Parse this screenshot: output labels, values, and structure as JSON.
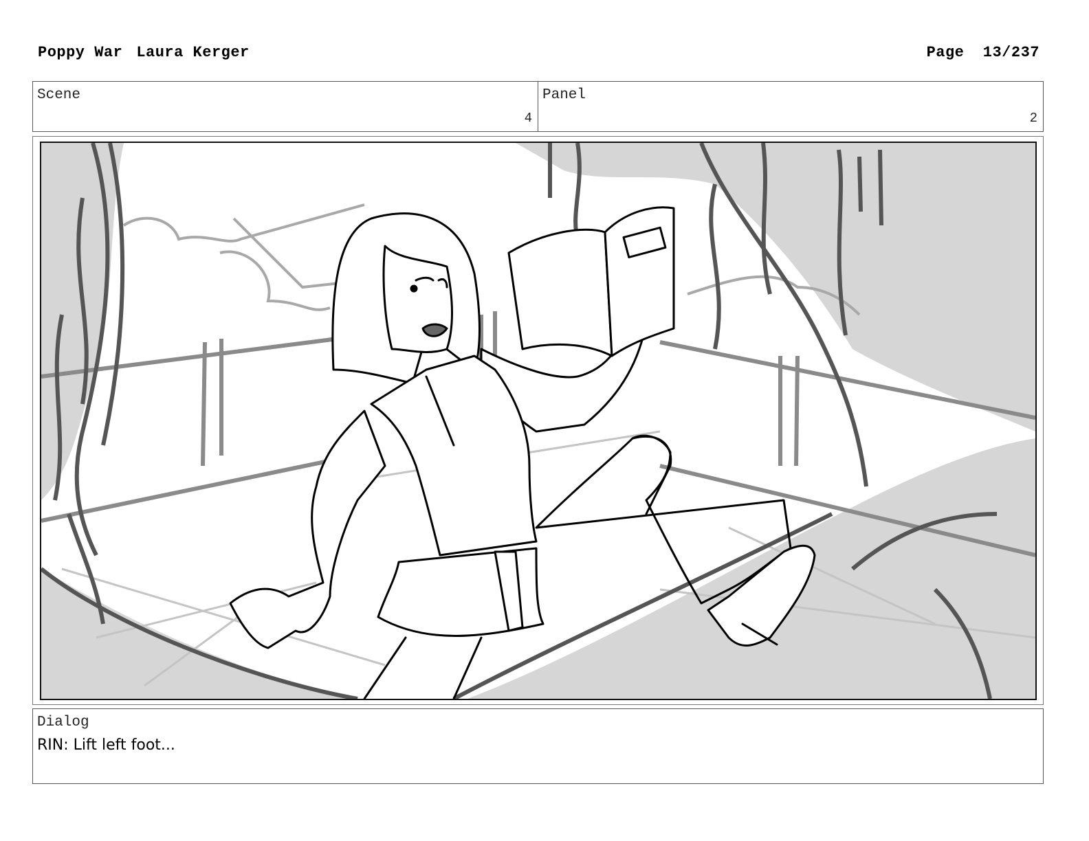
{
  "header": {
    "title": "Poppy War",
    "author": "Laura Kerger",
    "page_label": "Page",
    "page_number": "13/237"
  },
  "meta": {
    "scene_label": "Scene",
    "scene_value": "4",
    "panel_label": "Panel",
    "panel_value": "2"
  },
  "panel_image": {
    "content": "storyboard-sketch",
    "colors": {
      "ink": "#000000",
      "shade": "#d6d6d6",
      "pencil": "#8a8a8a"
    }
  },
  "dialog": {
    "label": "Dialog",
    "text": "RIN: Lift left foot..."
  }
}
